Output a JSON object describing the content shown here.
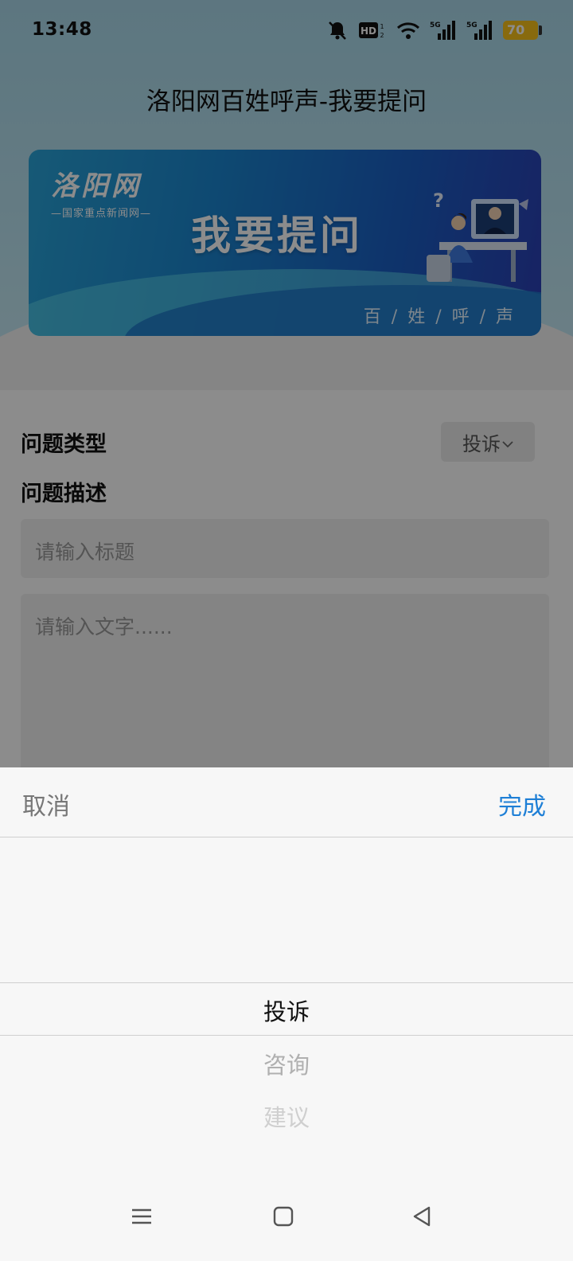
{
  "status": {
    "time": "13:48",
    "battery": "70",
    "network_1": "5G",
    "network_2": "5G",
    "hd_label": "HD"
  },
  "header": {
    "title": "洛阳网百姓呼声-我要提问"
  },
  "banner": {
    "logo_text": "洛阳网",
    "logo_subtitle": "—国家重点新闻网—",
    "heading": "我要提问",
    "tagline": "百 / 姓 / 呼 / 声"
  },
  "form": {
    "type_label": "问题类型",
    "type_value": "投诉",
    "desc_label": "问题描述",
    "title_placeholder": "请输入标题",
    "content_placeholder": "请输入文字......"
  },
  "picker": {
    "cancel_label": "取消",
    "done_label": "完成",
    "options": [
      "投诉",
      "咨询",
      "建议"
    ],
    "selected_index": 0
  },
  "colors": {
    "accent": "#1e7fd6",
    "battery": "#f7c21a"
  },
  "icons": {
    "status": [
      "mute-bell-icon",
      "hd-icon",
      "wifi-icon",
      "signal-icon",
      "signal-icon",
      "battery-icon"
    ],
    "nav": [
      "menu-icon",
      "home-icon",
      "back-icon"
    ],
    "select": "chevron-down-icon"
  }
}
